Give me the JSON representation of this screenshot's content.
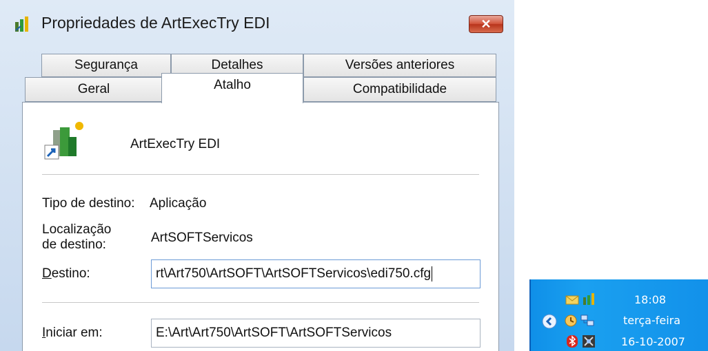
{
  "window": {
    "title": "Propriedades de ArtExecTry EDI",
    "close_symbol": "✕"
  },
  "tabs_top": [
    "Segurança",
    "Detalhes",
    "Versões anteriores"
  ],
  "tabs_bottom": [
    "Geral",
    "Atalho",
    "Compatibilidade"
  ],
  "active_tab": "Atalho",
  "shortcut": {
    "name": "ArtExecTry EDI",
    "target_type_label": "Tipo de destino:",
    "target_type_value": "Aplicação",
    "location_label_line1": "Localização",
    "location_label_line2": "de destino:",
    "location_value": "ArtSOFTServicos",
    "target_label_prefix": "D",
    "target_label_rest": "estino:",
    "target_value": "rt\\Art750\\ArtSOFT\\ArtSOFTServicos\\edi750.cfg",
    "start_in_label_prefix": "I",
    "start_in_label_rest": "niciar em:",
    "start_in_value": "E:\\Art\\Art750\\ArtSOFT\\ArtSOFTServicos"
  },
  "tray": {
    "time": "18:08",
    "day": "terça-feira",
    "date": "16-10-2007",
    "icons": [
      "mail-icon",
      "artexectry-icon",
      "expand-arrow-icon",
      "clock-app-icon",
      "network-icon",
      "bluetooth-icon",
      "tool-icon"
    ]
  }
}
